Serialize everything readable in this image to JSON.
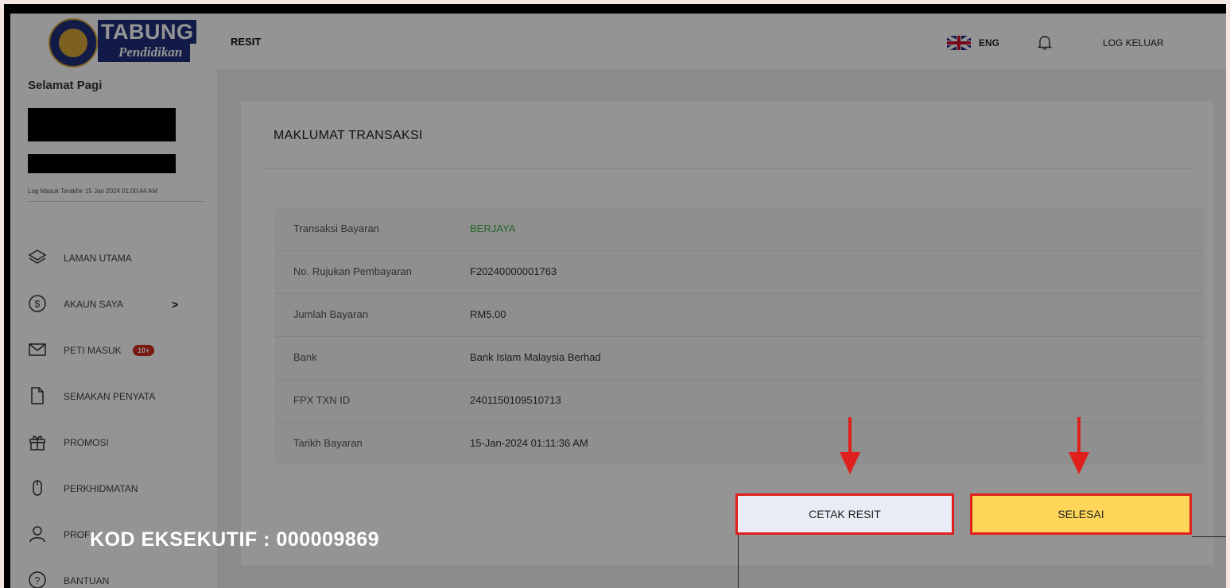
{
  "brand": {
    "line1": "TABUNG",
    "line2": "Pendidikan"
  },
  "topbar": {
    "title": "RESIT",
    "language": "ENG",
    "logout": "LOG KELUAR"
  },
  "sidebar": {
    "greeting": "Selamat Pagi",
    "last_login": "Log Masuk Terakhir 15 Jan 2024 01:00:44 AM",
    "items": [
      {
        "label": "LAMAN UTAMA",
        "icon": "layers-icon"
      },
      {
        "label": "AKAUN SAYA",
        "icon": "dollar-circle-icon",
        "chevron": ">"
      },
      {
        "label": "PETI MASUK",
        "icon": "mail-icon",
        "badge": "10+"
      },
      {
        "label": "SEMAKAN PENYATA",
        "icon": "document-icon"
      },
      {
        "label": "PROMOSI",
        "icon": "gift-icon"
      },
      {
        "label": "PERKHIDMATAN",
        "icon": "mouse-icon"
      },
      {
        "label": "PROFIL",
        "icon": "user-icon"
      },
      {
        "label": "BANTUAN",
        "icon": "help-icon"
      }
    ]
  },
  "card": {
    "title": "MAKLUMAT TRANSAKSI",
    "rows": [
      {
        "key": "Transaksi Bayaran",
        "value": "BERJAYA"
      },
      {
        "key": "No. Rujukan Pembayaran",
        "value": "F20240000001763"
      },
      {
        "key": "Jumlah Bayaran",
        "value": "RM5.00"
      },
      {
        "key": "Bank",
        "value": "Bank Islam Malaysia Berhad"
      },
      {
        "key": "FPX TXN ID",
        "value": "2401150109510713"
      },
      {
        "key": "Tarikh Bayaran",
        "value": "15-Jan-2024 01:11:36 AM"
      }
    ]
  },
  "buttons": {
    "print": "CETAK RESIT",
    "done": "SELESAI"
  },
  "watermark": "KOD EKSEKUTIF : 000009869",
  "colors": {
    "accent_red": "#e0201c",
    "done_yellow": "#ffd65a",
    "success_green": "#3cb04a",
    "brand_navy": "#1f2f7a"
  }
}
